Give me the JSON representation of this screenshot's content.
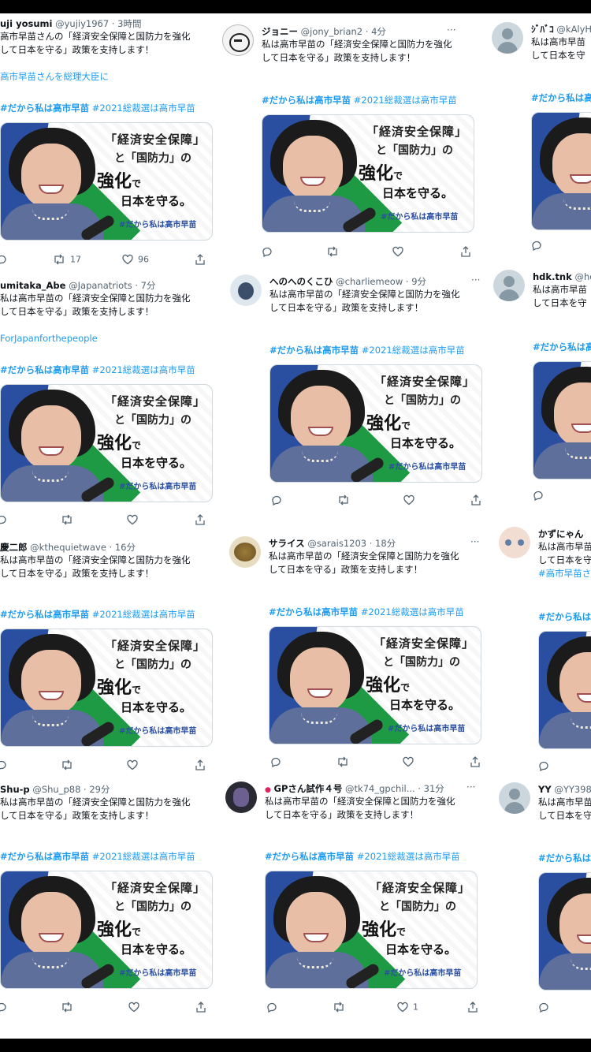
{
  "common": {
    "tweet_text_line1": "私は高市早苗の「経済安全保障と国防力を強化",
    "tweet_text_line2": "して日本を守る」政策を支持します！",
    "hashtag1": "#だから私は高市早苗",
    "hashtag2": "#2021総裁選は高市早苗",
    "more": "···",
    "card": {
      "quote_a": "「経済安全保障」",
      "quote_b": "と「国防力」の",
      "quote_c": "強化",
      "quote_c_small": "で",
      "quote_d": "日本を守る。",
      "quote_e": "#だから私は高市早苗"
    }
  },
  "tweets": [
    {
      "name": "uji yosumi",
      "handle": "@yujiy1967",
      "time": "· 3時間",
      "line1": "高市早苗さんの「経済安全保障と国防力を強化",
      "line2": "して日本を守る」政策を支持します！",
      "extra": "高市早苗さんを総理大臣に",
      "retweets": "17",
      "likes": "96",
      "replies": ""
    },
    {
      "name": "ジョニー",
      "handle": "@jony_brian2",
      "time": "· 4分",
      "line1": "私は高市早苗の「経済安全保障と国防力を強化",
      "line2": "して日本を守る」政策を支持します！",
      "extra": "",
      "retweets": "",
      "likes": "",
      "replies": ""
    },
    {
      "name": "ｼﾞﾊﾞｺ",
      "handle": "@kAlyH",
      "time": "",
      "line1": "私は高市早苗",
      "line2": "して日本を守",
      "extra": "",
      "retweets": "",
      "likes": "",
      "replies": ""
    },
    {
      "name": "umitaka_Abe",
      "handle": "@Japanatriots",
      "time": "· 7分",
      "line1": "私は高市早苗の「経済安全保障と国防力を強化",
      "line2": "して日本を守る」政策を支持します！",
      "extra": "ForJapanforthepeople",
      "retweets": "",
      "likes": "",
      "replies": ""
    },
    {
      "name": "へのへのくこひ",
      "handle": "@charliemeow",
      "time": "· 9分",
      "line1": "私は高市早苗の「経済安全保障と国防力を強化",
      "line2": "して日本を守る」政策を支持します！",
      "extra": "",
      "retweets": "",
      "likes": "",
      "replies": ""
    },
    {
      "name": "hdk.tnk",
      "handle": "@hd",
      "time": "",
      "line1": "私は高市早苗",
      "line2": "して日本を守",
      "extra": "",
      "retweets": "",
      "likes": "",
      "replies": ""
    },
    {
      "name": "慶二郎",
      "handle": "@kthequietwave",
      "time": "· 16分",
      "line1": "私は高市早苗の「経済安全保障と国防力を強化",
      "line2": "して日本を守る」政策を支持します！",
      "extra": "",
      "retweets": "",
      "likes": "",
      "replies": ""
    },
    {
      "name": "サライス",
      "handle": "@sarais1203",
      "time": "· 18分",
      "line1": "私は高市早苗の「経済安全保障と国防力を強化",
      "line2": "して日本を守る」政策を支持します！",
      "extra": "",
      "retweets": "",
      "likes": "",
      "replies": ""
    },
    {
      "name": "かずにゃん",
      "handle": "",
      "time": "",
      "line1": "私は高市早苗",
      "line2": "して日本を守",
      "extra": "#高市早苗さ",
      "retweets": "",
      "likes": "",
      "replies": ""
    },
    {
      "name": "Shu-p",
      "handle": "@Shu_p88",
      "time": "· 29分",
      "line1": "私は高市早苗の「経済安全保障と国防力を強化",
      "line2": "して日本を守る」政策を支持します！",
      "extra": "",
      "retweets": "",
      "likes": "",
      "replies": ""
    },
    {
      "name": "GPさん試作４号",
      "handle": "@tk74_gpchil...",
      "time": "· 31分",
      "line1": "私は高市早苗の「経済安全保障と国防力を強化",
      "line2": "して日本を守る」政策を支持します！",
      "extra": "",
      "retweets": "",
      "likes": "1",
      "replies": "",
      "dot": "●"
    },
    {
      "name": "YY",
      "handle": "@YY398",
      "time": "",
      "line1": "私は高市早苗",
      "line2": "して日本を守",
      "extra": "",
      "retweets": "",
      "likes": "",
      "replies": ""
    }
  ]
}
